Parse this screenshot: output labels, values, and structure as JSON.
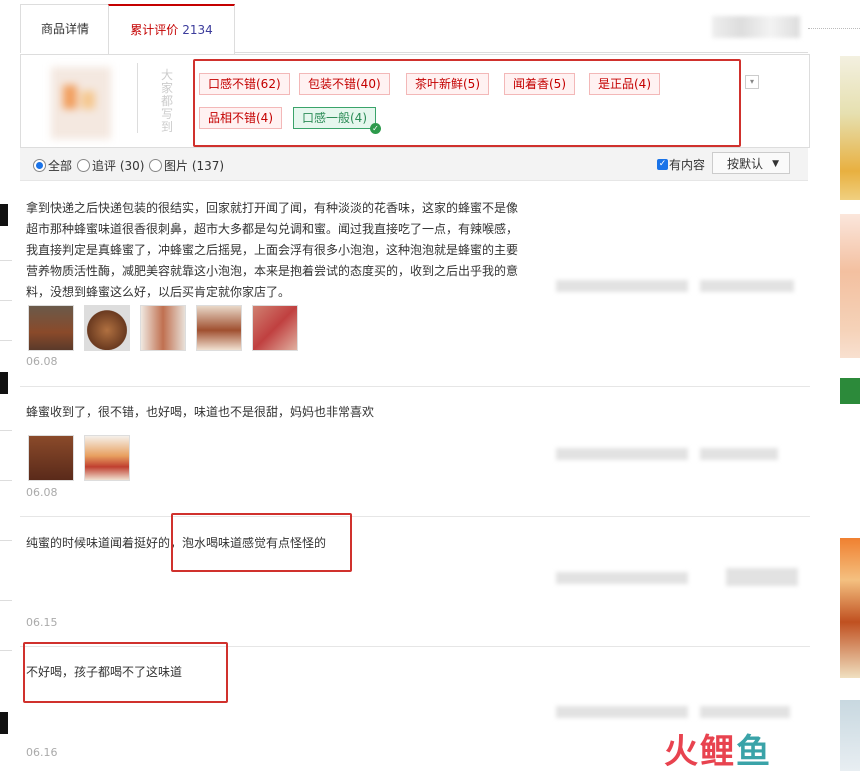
{
  "tabs": [
    {
      "label": "商品详情"
    },
    {
      "label": "累计评价",
      "count": "2134"
    }
  ],
  "impressions": {
    "side_label": "大家都写到",
    "tags": [
      {
        "label": "口感不错(62)"
      },
      {
        "label": "包装不错(40)"
      },
      {
        "label": "茶叶新鲜(5)"
      },
      {
        "label": "闻着香(5)"
      },
      {
        "label": "是正品(4)"
      },
      {
        "label": "品相不错(4)"
      },
      {
        "label": "口感一般(4)",
        "selected": true
      }
    ]
  },
  "filters": {
    "options": [
      {
        "label": "全部",
        "selected": true
      },
      {
        "label": "追评 (30)"
      },
      {
        "label": "图片 (137)"
      }
    ],
    "has_content_label": "有内容",
    "sort_label": "按默认"
  },
  "reviews": [
    {
      "lines": [
        "拿到快递之后快递包装的很结实，回家就打开闻了闻，有种淡淡的花香味，这家的蜂蜜不是像",
        "超市那种蜂蜜味道很香很刺鼻，超市大多都是勾兑调和蜜。闻过我直接吃了一点，有辣喉感，",
        "我直接判定是真蜂蜜了，冲蜂蜜之后摇晃，上面会浮有很多小泡泡，这种泡泡就是蜂蜜的主要",
        "营养物质活性酶，减肥美容就靠这小泡泡，本来是抱着尝试的态度买的，收到之后出乎我的意",
        "料，没想到蜂蜜这么好，以后买肯定就你家店了。"
      ],
      "date": "06.08",
      "photo_count": 5
    },
    {
      "lines": [
        "蜂蜜收到了，很不错，也好喝，味道也不是很甜，妈妈也非常喜欢"
      ],
      "date": "06.08",
      "photo_count": 2
    },
    {
      "lines": [
        "纯蜜的时候味道闻着挺好的，泡水喝味道感觉有点怪怪的"
      ],
      "date": "06.15",
      "photo_count": 0
    },
    {
      "lines": [
        "不好喝，孩子都喝不了这味道"
      ],
      "date": "06.16",
      "photo_count": 0
    }
  ],
  "watermark": {
    "text": "火鲤鱼",
    "color_primary": "#e8434f",
    "color_secondary": "#3aa3a8"
  },
  "colors": {
    "accent_red": "#c40000",
    "highlight_box": "#d0312d",
    "tag_green": "#2c8c57"
  }
}
